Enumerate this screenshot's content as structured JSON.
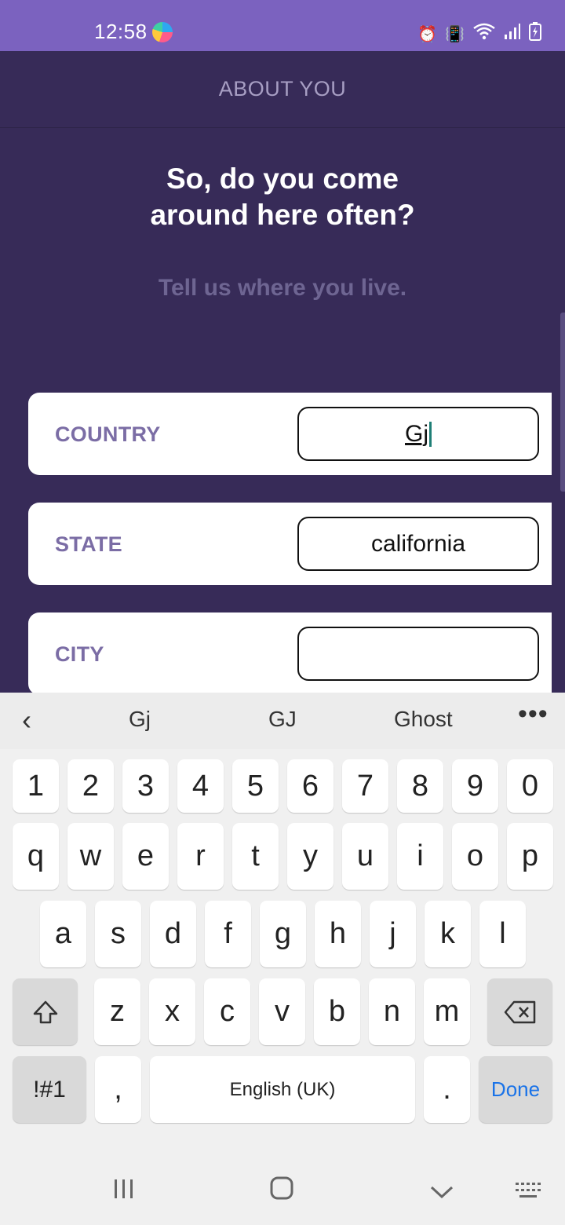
{
  "status_bar": {
    "time": "12:58",
    "icons": [
      "alarm-icon",
      "vibrate-icon",
      "wifi-icon",
      "signal-icon",
      "battery-icon"
    ]
  },
  "header": {
    "title": "ABOUT YOU"
  },
  "content": {
    "headline_line1": "So, do you come",
    "headline_line2": "around here often?",
    "subtitle": "Tell us where you live."
  },
  "fields": [
    {
      "label": "COUNTRY",
      "value": "Gj"
    },
    {
      "label": "STATE",
      "value": "california"
    },
    {
      "label": "CITY",
      "value": ""
    }
  ],
  "keyboard": {
    "suggestions": [
      "Gj",
      "GJ",
      "Ghost"
    ],
    "more": "•••",
    "row_numbers": [
      "1",
      "2",
      "3",
      "4",
      "5",
      "6",
      "7",
      "8",
      "9",
      "0"
    ],
    "row_top": [
      "q",
      "w",
      "e",
      "r",
      "t",
      "y",
      "u",
      "i",
      "o",
      "p"
    ],
    "row_mid": [
      "a",
      "s",
      "d",
      "f",
      "g",
      "h",
      "j",
      "k",
      "l"
    ],
    "row_bottom": [
      "z",
      "x",
      "c",
      "v",
      "b",
      "n",
      "m"
    ],
    "symbols_key": "!#1",
    "comma_key": ",",
    "space_label": "English (UK)",
    "period_key": ".",
    "done_label": "Done"
  },
  "colors": {
    "status_bar": "#7b62bf",
    "background": "#372b58",
    "label": "#7b6da5",
    "done": "#1a73e8"
  }
}
